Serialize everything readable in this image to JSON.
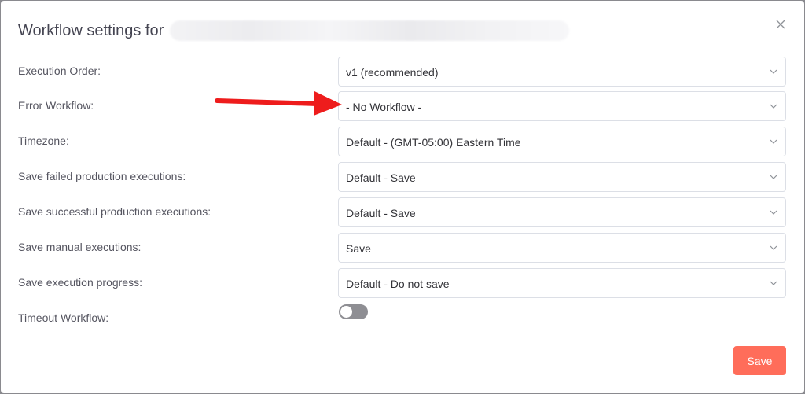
{
  "dialog": {
    "title": "Workflow settings for",
    "close_label": "×"
  },
  "settings": [
    {
      "label": "Execution Order:",
      "value": "v1 (recommended)"
    },
    {
      "label": "Error Workflow:",
      "value": "- No Workflow -"
    },
    {
      "label": "Timezone:",
      "value": "Default - (GMT-05:00) Eastern Time"
    },
    {
      "label": "Save failed production executions:",
      "value": "Default - Save"
    },
    {
      "label": "Save successful production executions:",
      "value": "Default - Save"
    },
    {
      "label": "Save manual executions:",
      "value": "Save"
    },
    {
      "label": "Save execution progress:",
      "value": "Default - Do not save"
    }
  ],
  "timeout": {
    "label": "Timeout Workflow:",
    "enabled": false
  },
  "footer": {
    "save_label": "Save"
  },
  "colors": {
    "primary_button": "#ff6d5a",
    "annotation_arrow": "#ee1c1c",
    "toggle_off": "#8e8e93"
  },
  "icons": {
    "close": "close-icon",
    "dropdown": "chevron-down-icon",
    "annotation": "red-arrow-annotation"
  }
}
